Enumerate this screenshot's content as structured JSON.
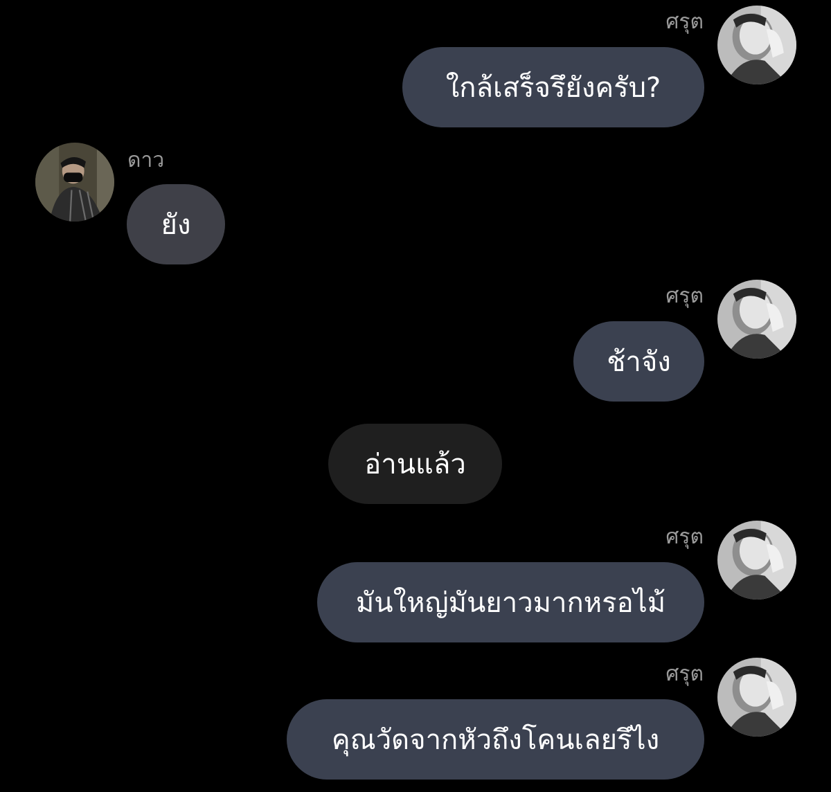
{
  "messages": [
    {
      "sender": "ศรุต",
      "side": "right",
      "text": "ใกล้เสร็จรึยังครับ?"
    },
    {
      "sender": "ดาว",
      "side": "left",
      "text": "ยัง"
    },
    {
      "sender": "ศรุต",
      "side": "right",
      "text": "ช้าจัง"
    },
    {
      "sender": "",
      "side": "center",
      "text": "อ่านแล้ว"
    },
    {
      "sender": "ศรุต",
      "side": "right",
      "text": "มันใหญ่มันยาวมากหรอไม้"
    },
    {
      "sender": "ศรุต",
      "side": "right",
      "text": "คุณวัดจากหัวถึงโคนเลยรึไง"
    }
  ],
  "colors": {
    "background": "#000000",
    "outgoing_bubble": "#3b4150",
    "incoming_bubble": "#3f4048",
    "system_bubble": "#1f1f1f",
    "name_text": "#9a9a9a"
  },
  "avatars": {
    "srut": "profile-photo-grayscale",
    "dao": "profile-photo-masked-man"
  }
}
